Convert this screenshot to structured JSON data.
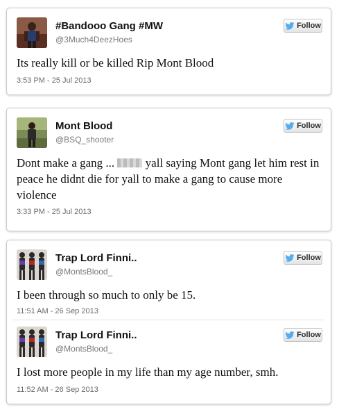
{
  "follow_label": "Follow",
  "tweets": [
    {
      "name": "#Bandooo Gang #MW",
      "handle": "@3Much4DeezHoes",
      "text": "Its really kill or be killed Rip Mont Blood",
      "timestamp": "3:53 PM - 25 Jul 2013"
    },
    {
      "name": "Mont Blood",
      "handle": "@BSQ_shooter",
      "text_before": "Dont make a gang ...",
      "text_after": "yall saying Mont gang let him rest in peace he didnt die for yall to make a gang to cause more violence",
      "timestamp": "3:33 PM - 25 Jul 2013"
    },
    {
      "name": "Trap Lord Finni..",
      "handle": "@MontsBlood_",
      "text": "I been through so much to only be 15.",
      "timestamp": "11:51 AM - 26 Sep 2013"
    },
    {
      "name": "Trap Lord Finni..",
      "handle": "@MontsBlood_",
      "text": "I lost more people in my life than my age number, smh.",
      "timestamp": "11:52 AM - 26 Sep 2013"
    }
  ],
  "colors": {
    "twitter_blue": "#55acee",
    "timestamp_gray": "#6a6a6a"
  }
}
